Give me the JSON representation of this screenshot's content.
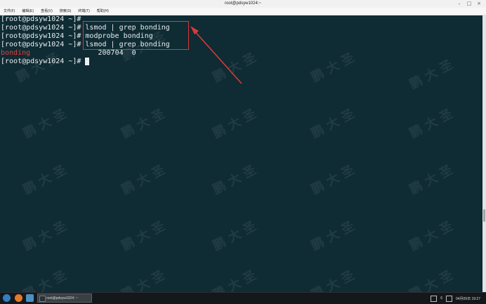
{
  "window": {
    "title": "root@pdsyw1024:~"
  },
  "menu": [
    "文件(F)",
    "编辑(E)",
    "查看(V)",
    "搜索(S)",
    "终端(T)",
    "帮助(H)"
  ],
  "terminal": {
    "lines": [
      {
        "prompt": "[root@pdsyw1024 ~]#",
        "cmd": ""
      },
      {
        "prompt": "[root@pdsyw1024 ~]#",
        "cmd": " lsmod | grep bonding"
      },
      {
        "prompt": "[root@pdsyw1024 ~]#",
        "cmd": " modprobe bonding"
      },
      {
        "prompt": "[root@pdsyw1024 ~]#",
        "cmd": " lsmod | grep bonding"
      },
      {
        "module": "bonding",
        "rest": "                200704  0"
      },
      {
        "prompt": "[root@pdsyw1024 ~]#",
        "cmd": " "
      }
    ]
  },
  "watermark": "鹏  大  圣",
  "taskbar": {
    "window_label": "root@pdsyw1024: ~",
    "tray_count": "6",
    "clock": "04月09日 19:27"
  },
  "colors": {
    "background": "#0f2b33",
    "highlight": "#d93a3a",
    "error_text": "#e63b3b"
  }
}
